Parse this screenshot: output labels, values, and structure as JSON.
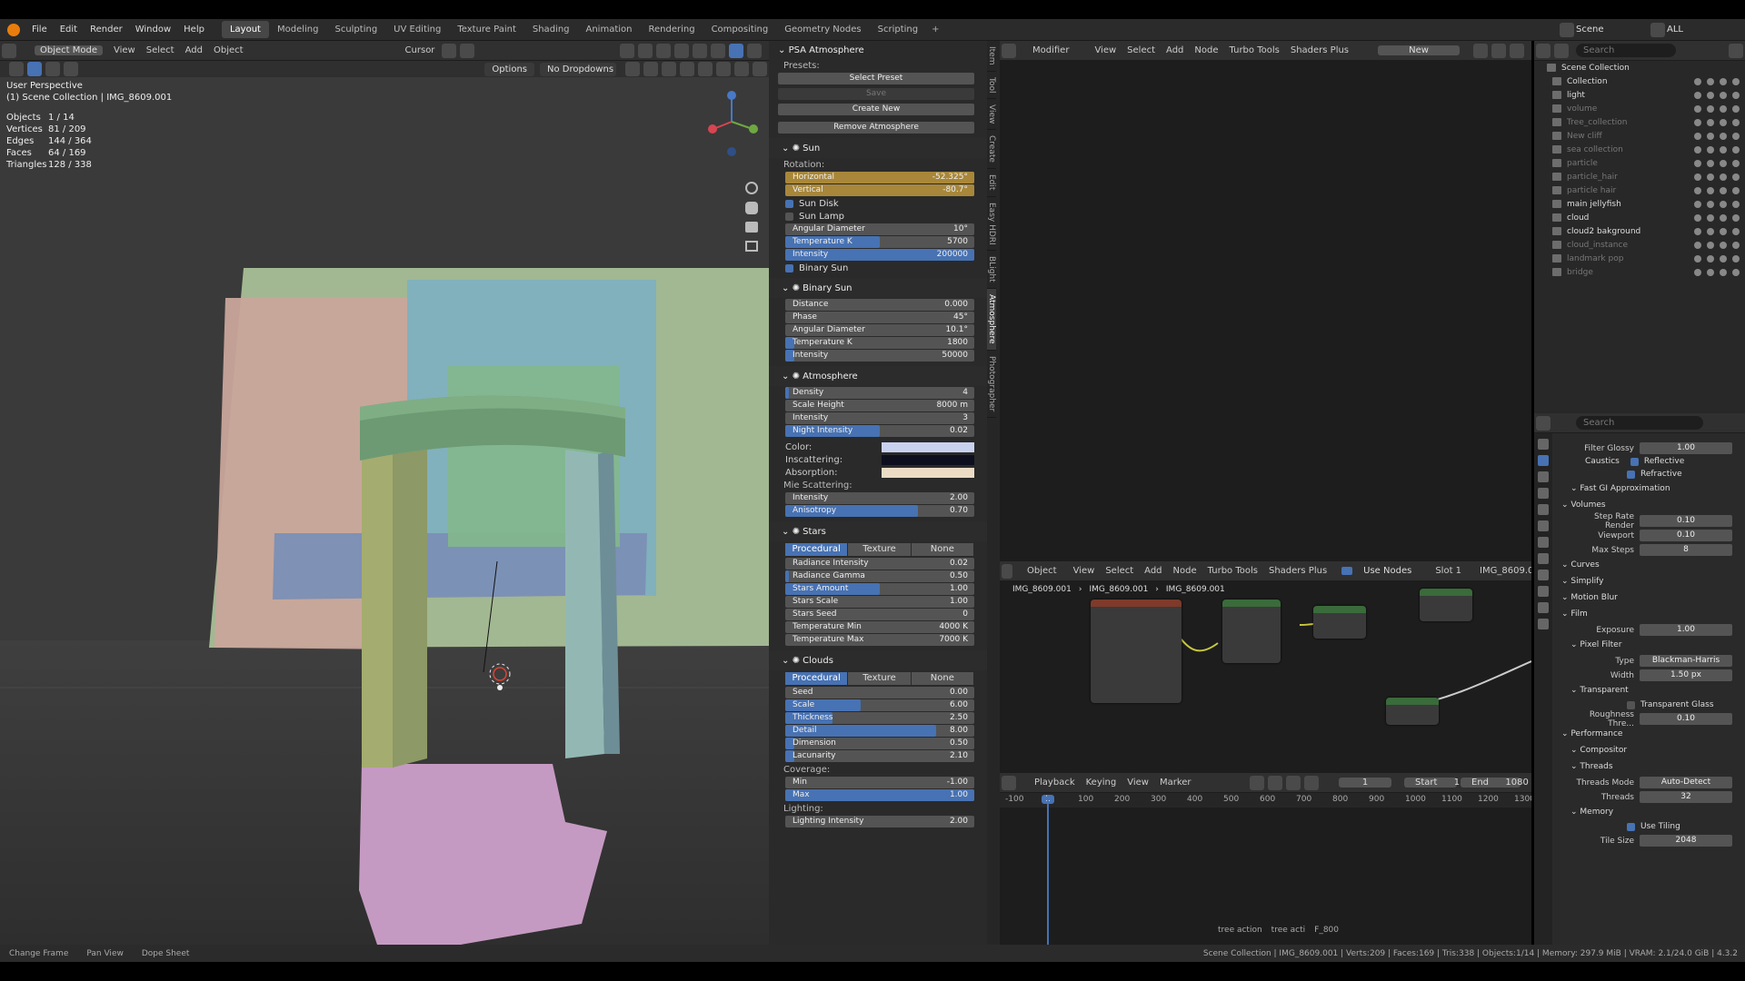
{
  "topbar": {
    "menus": [
      "File",
      "Edit",
      "Render",
      "Window",
      "Help"
    ],
    "workspaces": [
      "Layout",
      "Modeling",
      "Sculpting",
      "UV Editing",
      "Texture Paint",
      "Shading",
      "Animation",
      "Rendering",
      "Compositing",
      "Geometry Nodes",
      "Scripting"
    ],
    "active_workspace": "Layout",
    "scene": "Scene",
    "view_layer": "ALL"
  },
  "viewport": {
    "mode": "Object Mode",
    "menus": [
      "View",
      "Select",
      "Add",
      "Object"
    ],
    "transform": "Cursor",
    "options": "Options",
    "dropdown": "No Dropdowns",
    "perspective": "User Perspective",
    "collection": "(1) Scene Collection | IMG_8609.001",
    "stats": [
      {
        "k": "Objects",
        "v": "1 / 14"
      },
      {
        "k": "Vertices",
        "v": "81 / 209"
      },
      {
        "k": "Edges",
        "v": "144 / 364"
      },
      {
        "k": "Faces",
        "v": "64 / 169"
      },
      {
        "k": "Triangles",
        "v": "128 / 338"
      }
    ]
  },
  "npanel": {
    "title": "PSA Atmosphere",
    "presets_label": "Presets:",
    "select_preset": "Select Preset",
    "save": "Save",
    "create_new": "Create New",
    "remove": "Remove Atmosphere",
    "sun": {
      "title": "Sun",
      "rotation": "Rotation:",
      "horizontal": {
        "l": "Horizontal",
        "v": "-52.325°"
      },
      "vertical": {
        "l": "Vertical",
        "v": "-80.7°"
      },
      "sun_disk": "Sun Disk",
      "sun_lamp": "Sun Lamp",
      "angular": {
        "l": "Angular Diameter",
        "v": "10°"
      },
      "temp": {
        "l": "Temperature K",
        "v": "5700",
        "f": 0.5
      },
      "intensity": {
        "l": "Intensity",
        "v": "200000",
        "f": 1
      },
      "binary": "Binary Sun"
    },
    "binary": {
      "title": "Binary Sun",
      "fields": [
        {
          "l": "Distance",
          "v": "0.000",
          "f": 0
        },
        {
          "l": "Phase",
          "v": "45°",
          "f": 0
        },
        {
          "l": "Angular Diameter",
          "v": "10.1°",
          "f": 0
        },
        {
          "l": "Temperature K",
          "v": "1800",
          "f": 0.05
        },
        {
          "l": "Intensity",
          "v": "50000",
          "f": 0.05
        }
      ]
    },
    "atmosphere": {
      "title": "Atmosphere",
      "fields": [
        {
          "l": "Density",
          "v": "4",
          "f": 0.02
        },
        {
          "l": "Scale Height",
          "v": "8000 m",
          "f": 0
        },
        {
          "l": "Intensity",
          "v": "3",
          "f": 0
        },
        {
          "l": "Night Intensity",
          "v": "0.02",
          "f": 0.5
        }
      ],
      "color": "Color:",
      "inscattering": "Inscattering:",
      "absorption": "Absorption:",
      "color_hex": "#c8d2ef",
      "inscat_hex": "#0d0f1e",
      "absorp_hex": "#ecdcc6",
      "mie": "Mie Scattering:",
      "mie_fields": [
        {
          "l": "Intensity",
          "v": "2.00",
          "f": 0
        },
        {
          "l": "Anisotropy",
          "v": "0.70",
          "f": 0.7
        }
      ]
    },
    "stars": {
      "title": "Stars",
      "tabs": [
        "Procedural",
        "Texture",
        "None"
      ],
      "fields": [
        {
          "l": "Radiance Intensity",
          "v": "0.02",
          "f": 0
        },
        {
          "l": "Radiance Gamma",
          "v": "0.50",
          "f": 0.02
        },
        {
          "l": "Stars Amount",
          "v": "1.00",
          "f": 0.5
        },
        {
          "l": "Stars Scale",
          "v": "1.00",
          "f": 0
        },
        {
          "l": "Stars Seed",
          "v": "0",
          "f": 0
        },
        {
          "l": "Temperature Min",
          "v": "4000 K",
          "f": 0
        },
        {
          "l": "Temperature Max",
          "v": "7000 K",
          "f": 0
        }
      ]
    },
    "clouds": {
      "title": "Clouds",
      "tabs": [
        "Procedural",
        "Texture",
        "None"
      ],
      "fields": [
        {
          "l": "Seed",
          "v": "0.00",
          "f": 0
        },
        {
          "l": "Scale",
          "v": "6.00",
          "f": 0.4
        },
        {
          "l": "Thickness",
          "v": "2.50",
          "f": 0.25
        },
        {
          "l": "Detail",
          "v": "8.00",
          "f": 0.8
        },
        {
          "l": "Dimension",
          "v": "0.50",
          "f": 0.05
        },
        {
          "l": "Lacunarity",
          "v": "2.10",
          "f": 0.05
        }
      ],
      "coverage": "Coverage:",
      "cov_fields": [
        {
          "l": "Min",
          "v": "-1.00",
          "f": 0
        },
        {
          "l": "Max",
          "v": "1.00",
          "f": 1
        }
      ],
      "lighting": "Lighting:",
      "light_fields": [
        {
          "l": "Lighting Intensity",
          "v": "2.00",
          "f": 0
        }
      ]
    }
  },
  "ntabs": [
    "Item",
    "Tool",
    "View",
    "Create",
    "Edit",
    "Easy HDRI",
    "BLight",
    "Atmosphere",
    "Photographer"
  ],
  "node_editor": {
    "type": "Modifier",
    "menus": [
      "View",
      "Select",
      "Add",
      "Node",
      "Turbo Tools",
      "Shaders Plus"
    ],
    "new": "New"
  },
  "shader_editor": {
    "type": "Object",
    "menus": [
      "View",
      "Select",
      "Add",
      "Node",
      "Turbo Tools",
      "Shaders Plus"
    ],
    "use_nodes": "Use Nodes",
    "slot": "Slot 1",
    "material": "IMG_8609.0",
    "breadcrumb": [
      "IMG_8609.001",
      "IMG_8609.001",
      "IMG_8609.001"
    ]
  },
  "timeline": {
    "menus": [
      "Playback",
      "Keying",
      "View",
      "Marker"
    ],
    "frame": "1",
    "start": "Start",
    "start_v": "1",
    "end": "End",
    "end_v": "1080",
    "ticks": [
      "-100",
      "1",
      "100",
      "200",
      "300",
      "400",
      "500",
      "600",
      "700",
      "800",
      "900",
      "1000",
      "1100",
      "1200",
      "1300"
    ],
    "markers": [
      "tree action",
      "tree acti",
      "F_800"
    ]
  },
  "outliner": {
    "search": "Search",
    "items": [
      {
        "n": "Scene Collection",
        "d": false
      },
      {
        "n": "Collection",
        "d": false
      },
      {
        "n": "light",
        "d": false
      },
      {
        "n": "volume",
        "d": true
      },
      {
        "n": "Tree_collection",
        "d": true
      },
      {
        "n": "New cliff",
        "d": true
      },
      {
        "n": "sea collection",
        "d": true
      },
      {
        "n": "particle",
        "d": true
      },
      {
        "n": "particle_hair",
        "d": true
      },
      {
        "n": "particle hair",
        "d": true
      },
      {
        "n": "main jellyfish",
        "d": false
      },
      {
        "n": "cloud",
        "d": false
      },
      {
        "n": "cloud2 bakground",
        "d": false
      },
      {
        "n": "cloud_instance",
        "d": true
      },
      {
        "n": "landmark pop",
        "d": true
      },
      {
        "n": "bridge",
        "d": true
      }
    ]
  },
  "props": {
    "search": "Search",
    "filter_glossy": {
      "l": "Filter Glossy",
      "v": "1.00"
    },
    "caustics": "Caustics",
    "reflective": "Reflective",
    "refractive": "Refractive",
    "fast_gi": "Fast GI Approximation",
    "volumes": "Volumes",
    "step_rate": {
      "l": "Step Rate Render",
      "v": "0.10"
    },
    "viewport": {
      "l": "Viewport",
      "v": "0.10"
    },
    "max_steps": {
      "l": "Max Steps",
      "v": "8"
    },
    "curves": "Curves",
    "simplify": "Simplify",
    "motion_blur": "Motion Blur",
    "film": "Film",
    "exposure": {
      "l": "Exposure",
      "v": "1.00"
    },
    "pixel_filter": "Pixel Filter",
    "type": {
      "l": "Type",
      "v": "Blackman-Harris"
    },
    "width": {
      "l": "Width",
      "v": "1.50 px"
    },
    "transparent": "Transparent",
    "transparent_glass": "Transparent Glass",
    "roughness": {
      "l": "Roughness Thre...",
      "v": "0.10"
    },
    "performance": "Performance",
    "compositor": "Compositor",
    "threads": "Threads",
    "threads_mode": {
      "l": "Threads Mode",
      "v": "Auto-Detect"
    },
    "threads_v": {
      "l": "Threads",
      "v": "32"
    },
    "memory": "Memory",
    "use_tiling": "Use Tiling",
    "tile_size": {
      "l": "Tile Size",
      "v": "2048"
    }
  },
  "statusbar": {
    "left": [
      "Change Frame",
      "Pan View",
      "Dope Sheet"
    ],
    "right": "Scene Collection | IMG_8609.001 | Verts:209 | Faces:169 | Tris:338 | Objects:1/14 | Memory: 297.9 MiB | VRAM: 2.1/24.0 GiB | 4.3.2"
  }
}
